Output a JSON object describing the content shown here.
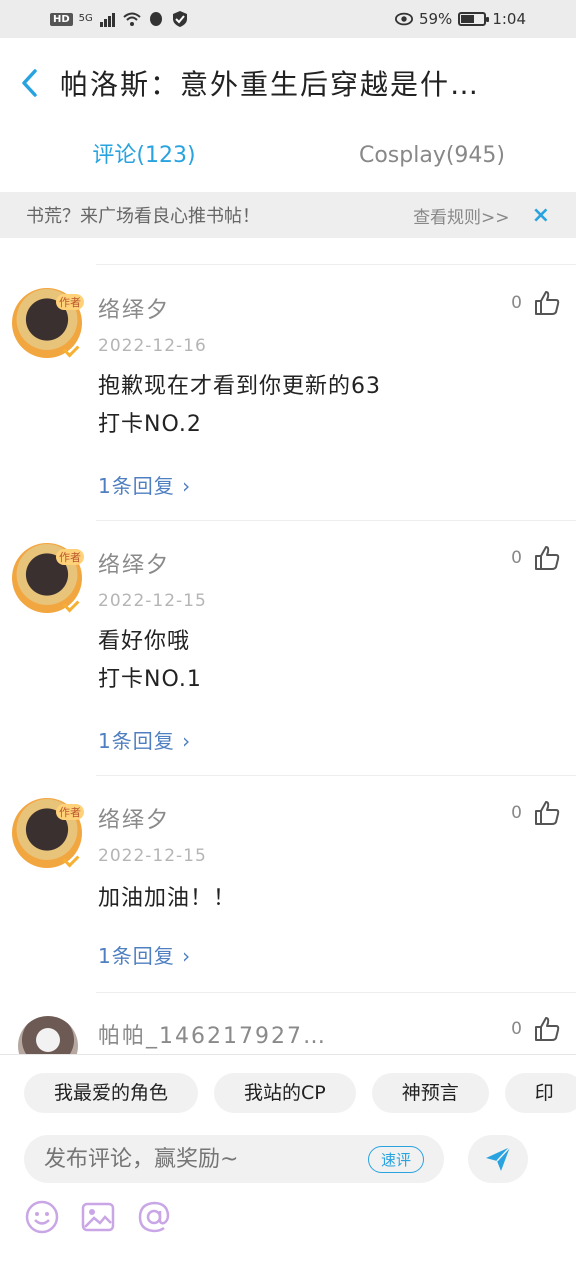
{
  "status_bar": {
    "hd": "HD",
    "net": "5G",
    "battery_percent": "59%",
    "battery_level": 0.59,
    "time": "1:04"
  },
  "header": {
    "title": "帕洛斯：意外重生后穿越是什…"
  },
  "tabs": [
    {
      "label": "评论(123)",
      "active": true
    },
    {
      "label": "Cosplay(945)",
      "active": false
    }
  ],
  "notice": {
    "text": "书荒？来广场看良心推书帖！",
    "rules": "查看规则>>",
    "close": "×"
  },
  "comments": [
    {
      "username": "络绎夕",
      "badge": "作者",
      "date": "2022-12-16",
      "lines": [
        "抱歉现在才看到你更新的63",
        "打卡NO.2"
      ],
      "likes": "0",
      "replies": "1条回复 ›"
    },
    {
      "username": "络绎夕",
      "badge": "作者",
      "date": "2022-12-15",
      "lines": [
        "看好你哦",
        "打卡NO.1"
      ],
      "likes": "0",
      "replies": "1条回复 ›"
    },
    {
      "username": "络绎夕",
      "badge": "作者",
      "date": "2022-12-15",
      "lines": [
        "加油加油！！"
      ],
      "likes": "0",
      "replies": "1条回复 ›"
    },
    {
      "username": "帕帕_146217927…",
      "likes": "0"
    }
  ],
  "bottom": {
    "chips": [
      "我最爱的角色",
      "我站的CP",
      "神预言",
      "印"
    ],
    "input_placeholder": "发布评论，赢奖励~",
    "quick_review": "速评"
  },
  "colors": {
    "accent": "#29a3e0",
    "reply_link": "#4f7fc0"
  }
}
